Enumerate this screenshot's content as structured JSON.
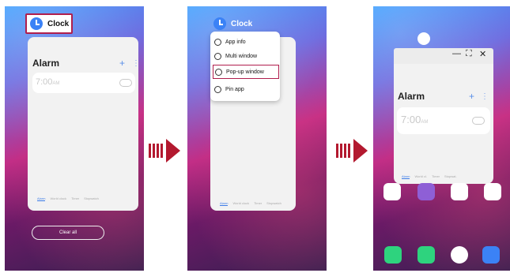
{
  "flow_arrows": [
    {
      "name": "arrow-1"
    },
    {
      "name": "arrow-2"
    }
  ],
  "panel1": {
    "app_button_label": "Clock",
    "card": {
      "title": "Alarm",
      "alarm_time": "7:00",
      "ampm": "AM",
      "tabs": [
        "Alarm",
        "World clock",
        "Timer",
        "Stopwatch"
      ]
    },
    "clear_all": "Clear all"
  },
  "panel2": {
    "app_title": "Clock",
    "menu": [
      {
        "label": "App info",
        "icon": "info-icon"
      },
      {
        "label": "Multi window",
        "icon": "multiwindow-icon"
      },
      {
        "label": "Pop-up window",
        "icon": "popup-icon"
      },
      {
        "label": "Pin app",
        "icon": "pin-icon"
      }
    ],
    "card": {
      "tabs": [
        "Alarm",
        "World clock",
        "Timer",
        "Stopwatch"
      ]
    }
  },
  "panel3": {
    "popup": {
      "controls": [
        "—",
        "⛶",
        "✕"
      ],
      "title": "Alarm",
      "alarm_time": "7:00",
      "ampm": "AM",
      "tabs": [
        "Alarm",
        "World cl.",
        "Timer",
        "Stopwat."
      ]
    },
    "home_icons": [
      "gmail-icon",
      "app-icon",
      "playstore-icon",
      "calendar-icon",
      "phone-icon",
      "messages-icon",
      "chrome-icon",
      "camera-icon"
    ]
  },
  "colors": {
    "highlight": "#b01e4d",
    "arrow": "#b3192f",
    "accent": "#3c7ce8"
  }
}
